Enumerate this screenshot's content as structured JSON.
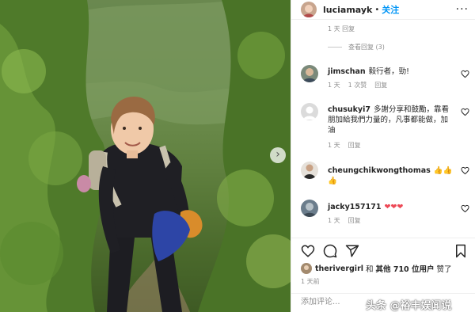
{
  "header": {
    "username": "luciamayk",
    "dot": "•",
    "follow_label": "关注",
    "more_label": "···"
  },
  "thread": {
    "prior_meta": "1 天  回复",
    "view_replies_label": "查看回复 (3)"
  },
  "comments": [
    {
      "user": "jimschan",
      "text": "毅行者，勁!",
      "time": "1 天",
      "likes": "1 次赞",
      "reply": "回复"
    },
    {
      "user": "chusukyi7",
      "text": "多謝分享和鼓勵，靠看朋加給我們力量的，凡事都能做，加油",
      "time": "1 天",
      "likes": "",
      "reply": "回复"
    },
    {
      "user": "cheungchikwongthomas",
      "text": "👍👍👍",
      "time": "",
      "likes": "",
      "reply": ""
    },
    {
      "user": "jacky157171",
      "text": "❤❤❤",
      "time": "1 天",
      "likes": "",
      "reply": "回复"
    }
  ],
  "likes": {
    "user": "therivergirl",
    "connector": "和",
    "others": "其他 710 位用户",
    "suffix": "赞了"
  },
  "time_ago": "1 天前",
  "add_comment_placeholder": "添加评论...",
  "watermark": "头条 @裕丰娱闻说",
  "colors": {
    "accent": "#0095f6",
    "text": "#262626",
    "muted": "#8e8e8e",
    "heart_red": "#ed4956"
  },
  "icons": [
    "heart-icon",
    "comment-icon",
    "share-icon",
    "bookmark-icon",
    "more-icon",
    "chevron-right-icon"
  ]
}
